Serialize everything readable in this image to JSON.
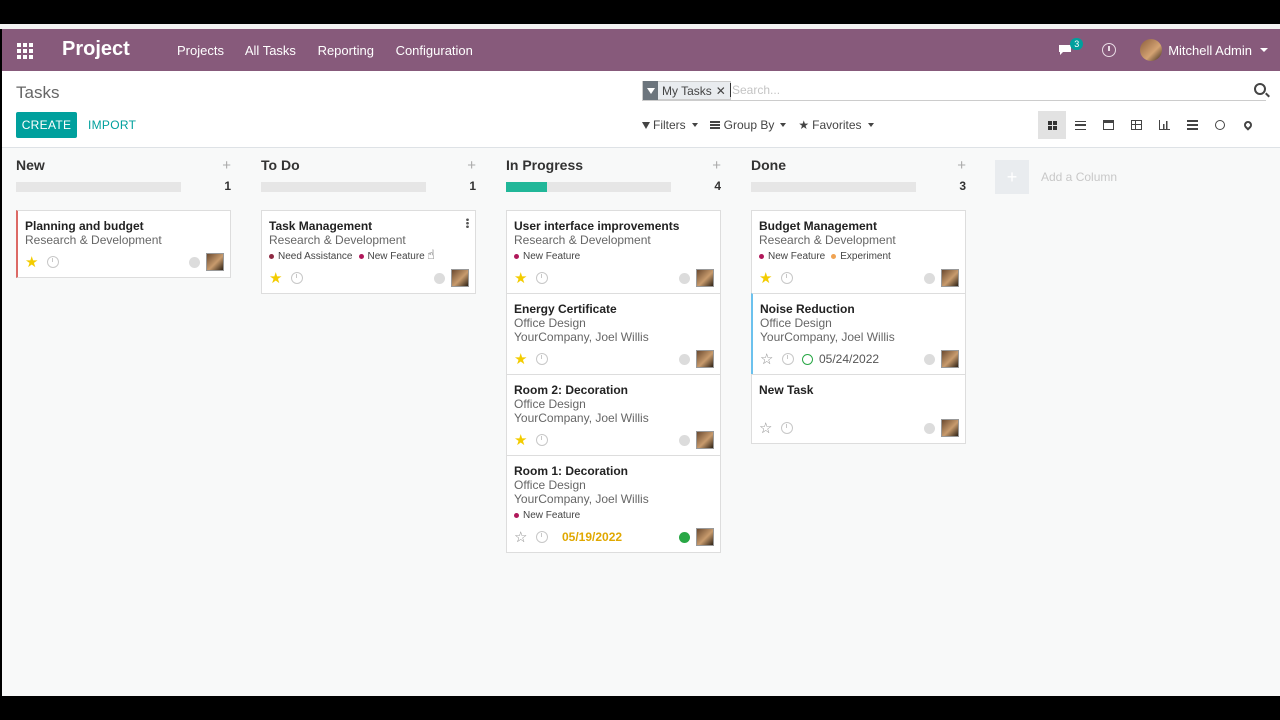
{
  "navbar": {
    "brand": "Project",
    "menu": [
      "Projects",
      "All Tasks",
      "Reporting",
      "Configuration"
    ],
    "message_count": "3",
    "user_name": "Mitchell Admin",
    "color": "#875a7b"
  },
  "control_panel": {
    "breadcrumb": "Tasks",
    "facet_label": "My Tasks",
    "search_placeholder": "Search...",
    "create_label": "CREATE",
    "import_label": "IMPORT",
    "filters_label": "Filters",
    "group_by_label": "Group By",
    "favorites_label": "Favorites"
  },
  "columns": [
    {
      "title": "New",
      "count": "1",
      "progress": 0,
      "cards": [
        {
          "title": "Planning and budget",
          "lines": [
            "Research & Development"
          ],
          "tags": [],
          "starred": true,
          "bar": "red",
          "deadline": "",
          "state": "grey"
        }
      ]
    },
    {
      "title": "To Do",
      "count": "1",
      "progress": 0,
      "cards": [
        {
          "title": "Task Management",
          "lines": [
            "Research & Development"
          ],
          "tags": [
            {
              "name": "Need Assistance",
              "color": "#8e2a43"
            },
            {
              "name": "New Feature",
              "color": "#b0185a"
            }
          ],
          "starred": true,
          "bar": "",
          "deadline": "",
          "state": "grey",
          "kebab": true
        }
      ]
    },
    {
      "title": "In Progress",
      "count": "4",
      "progress": 0.25,
      "cards": [
        {
          "title": "User interface improvements",
          "lines": [
            "Research & Development"
          ],
          "tags": [
            {
              "name": "New Feature",
              "color": "#b0185a"
            }
          ],
          "starred": true,
          "bar": "",
          "deadline": "",
          "state": "grey"
        },
        {
          "title": "Energy Certificate",
          "lines": [
            "Office Design",
            "YourCompany, Joel Willis"
          ],
          "tags": [],
          "starred": true,
          "bar": "",
          "deadline": "",
          "state": "grey"
        },
        {
          "title": "Room 2: Decoration",
          "lines": [
            "Office Design",
            "YourCompany, Joel Willis"
          ],
          "tags": [],
          "starred": true,
          "bar": "",
          "deadline": "",
          "state": "grey"
        },
        {
          "title": "Room 1: Decoration",
          "lines": [
            "Office Design",
            "YourCompany, Joel Willis"
          ],
          "tags": [
            {
              "name": "New Feature",
              "color": "#b0185a"
            }
          ],
          "starred": false,
          "bar": "",
          "deadline": "05/19/2022",
          "deadline_style": "warn",
          "state": "green"
        }
      ]
    },
    {
      "title": "Done",
      "count": "3",
      "progress": 0,
      "cards": [
        {
          "title": "Budget Management",
          "lines": [
            "Research & Development"
          ],
          "tags": [
            {
              "name": "New Feature",
              "color": "#b0185a"
            },
            {
              "name": "Experiment",
              "color": "#f0a352"
            }
          ],
          "starred": true,
          "bar": "",
          "deadline": "",
          "state": "grey"
        },
        {
          "title": "Noise Reduction",
          "lines": [
            "Office Design",
            "YourCompany, Joel Willis"
          ],
          "tags": [],
          "starred": false,
          "bar": "blue",
          "deadline": "05/24/2022",
          "deadline_style": "smile",
          "state": "grey"
        },
        {
          "title": "New Task",
          "lines": [],
          "tags": [],
          "starred": false,
          "bar": "",
          "deadline": "",
          "state": "grey"
        }
      ]
    }
  ],
  "add_column_label": "Add a Column"
}
